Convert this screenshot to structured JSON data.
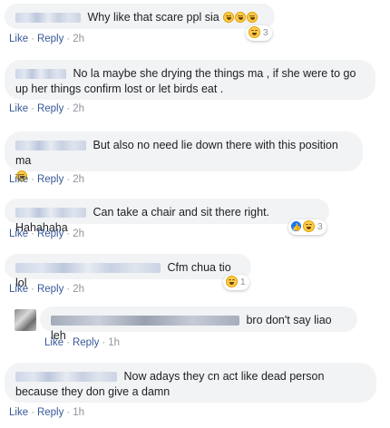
{
  "actions": {
    "like": "Like",
    "reply": "Reply",
    "separator": "·"
  },
  "comments": [
    {
      "text": "Why like that scare ppl sia",
      "time": "2h",
      "reaction_count": "3"
    },
    {
      "text": "No la maybe she drying the things ma , if she were to go up her things confirm lost or let birds eat .",
      "time": "2h"
    },
    {
      "text": "But also no need lie down there with this position ma",
      "time": "2h"
    },
    {
      "text": "Can take a chair and sit there right. Hahahaha",
      "time": "2h",
      "reaction_count": "3"
    },
    {
      "text": "Cfm chua tio lol",
      "time": "2h",
      "reaction_count": "1"
    },
    {
      "text": "bro don't say liao leh",
      "time": "1h"
    },
    {
      "text": "Now adays they cn act like dead person because they don give a damn",
      "time": "1h"
    }
  ],
  "icons": {
    "laugh": "laughing-emoji-icon",
    "like": "like-reaction-icon"
  },
  "colors": {
    "bubble": "#f2f3f5",
    "link": "#385898",
    "muted": "#90949c",
    "like_blue": "#1877f2",
    "emoji_yellow": "#ffcc4d"
  }
}
